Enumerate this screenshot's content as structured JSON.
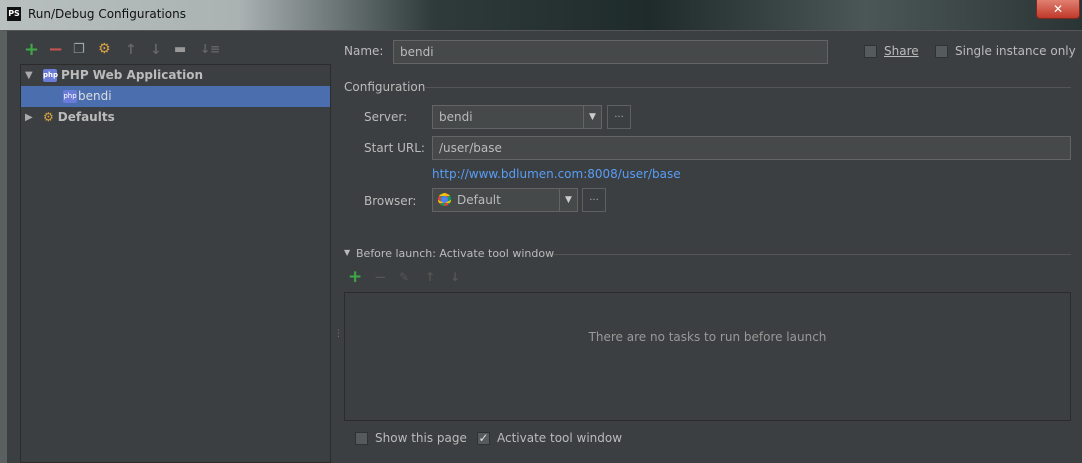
{
  "window": {
    "title": "Run/Debug Configurations",
    "app_icon": "PS",
    "close_label": "✕"
  },
  "toolbar": {
    "icons": [
      "add-icon",
      "remove-icon",
      "copy-icon",
      "edit-defaults-icon",
      "move-up-icon",
      "move-down-icon",
      "folder-icon",
      "sort-icon"
    ]
  },
  "tree": {
    "items": [
      {
        "label": "PHP Web Application",
        "expanded": true
      },
      {
        "label": "bendi",
        "selected": true
      },
      {
        "label": "Defaults",
        "expanded": false
      }
    ]
  },
  "form": {
    "name_label": "Name:",
    "name_value": "bendi",
    "share_label": "Share",
    "single_instance_label": "Single instance only",
    "configuration_heading": "Configuration",
    "server_label": "Server:",
    "server_value": "bendi",
    "start_url_label": "Start URL:",
    "start_url_value": "/user/base",
    "full_url": "http://www.bdlumen.com:8008/user/base",
    "browser_label": "Browser:",
    "browser_value": "Default",
    "more_label": "..."
  },
  "before_launch": {
    "heading": "Before launch: Activate tool window",
    "empty_text": "There are no tasks to run before launch",
    "show_page_label": "Show this page",
    "show_page_checked": false,
    "activate_label": "Activate tool window",
    "activate_checked": true
  },
  "colors": {
    "accent": "#4b6eaf",
    "link": "#589df6",
    "add": "#3fa846",
    "remove": "#c75450"
  }
}
